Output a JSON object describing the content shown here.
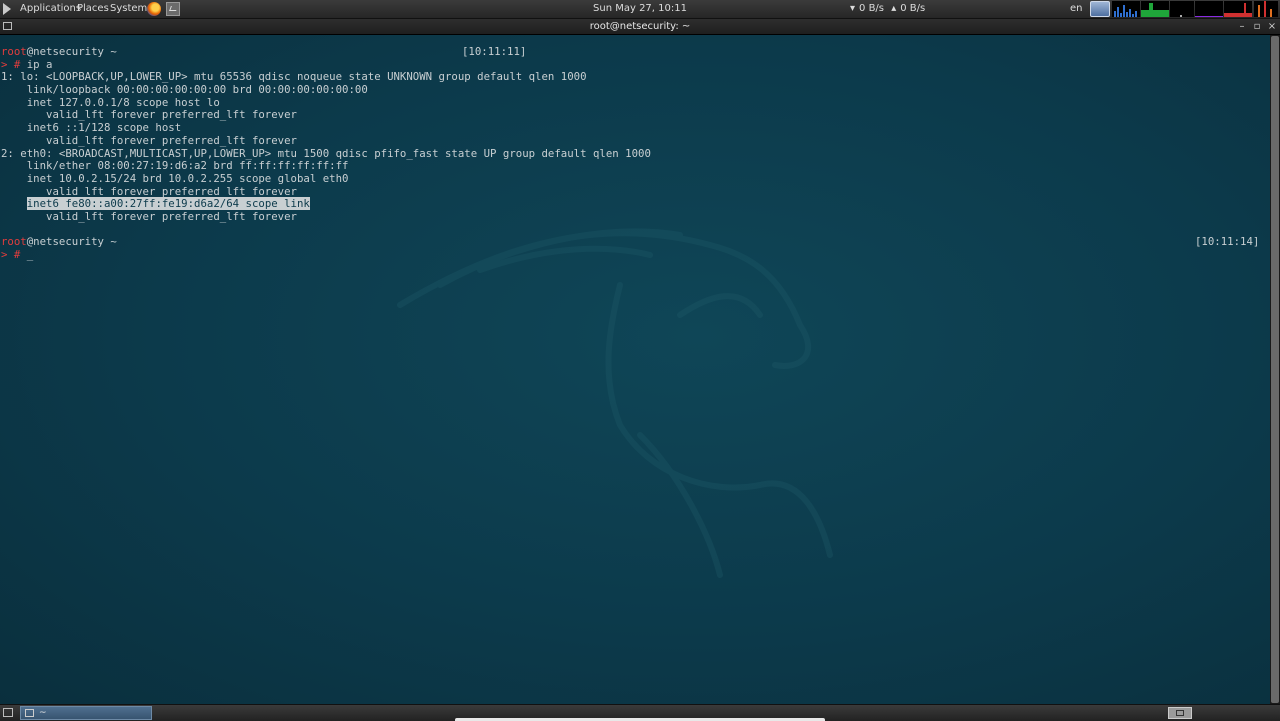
{
  "top_panel": {
    "menu": [
      "Applications",
      "Places",
      "System"
    ],
    "clock": "Sun May 27, 10:11",
    "net_down": "0 B/s",
    "net_up": "0 B/s",
    "language": "en"
  },
  "window": {
    "title": "root@netsecurity: ~",
    "buttons": [
      "–",
      "▫",
      "×"
    ]
  },
  "terminal": {
    "lines": [
      {
        "type": "prompt-info",
        "user": "root",
        "host": "@netsecurity ~",
        "time": "[10:11:11]"
      },
      {
        "type": "prompt",
        "arrow": ">",
        "hash": "#",
        "text": " ip a"
      },
      {
        "type": "text",
        "text": "1: lo: <LOOPBACK,UP,LOWER_UP> mtu 65536 qdisc noqueue state UNKNOWN group default qlen 1000"
      },
      {
        "type": "text",
        "text": "    link/loopback 00:00:00:00:00:00 brd 00:00:00:00:00:00"
      },
      {
        "type": "text",
        "text": "    inet 127.0.0.1/8 scope host lo"
      },
      {
        "type": "text",
        "text": "       valid_lft forever preferred_lft forever"
      },
      {
        "type": "text",
        "text": "    inet6 ::1/128 scope host"
      },
      {
        "type": "text",
        "text": "       valid_lft forever preferred_lft forever"
      },
      {
        "type": "text",
        "text": "2: eth0: <BROADCAST,MULTICAST,UP,LOWER_UP> mtu 1500 qdisc pfifo_fast state UP group default qlen 1000"
      },
      {
        "type": "text",
        "text": "    link/ether 08:00:27:19:d6:a2 brd ff:ff:ff:ff:ff:ff"
      },
      {
        "type": "text",
        "text": "    inet 10.0.2.15/24 brd 10.0.2.255 scope global eth0"
      },
      {
        "type": "text",
        "text": "       valid_lft forever preferred_lft forever"
      },
      {
        "type": "highlight",
        "indent": "    ",
        "text": "inet6 fe80::a00:27ff:fe19:d6a2/64 scope link"
      },
      {
        "type": "text",
        "text": "       valid_lft forever preferred_lft forever"
      },
      {
        "type": "blank",
        "text": ""
      },
      {
        "type": "prompt-info",
        "user": "root",
        "host": "@netsecurity ~",
        "time": "[10:11:14]"
      },
      {
        "type": "prompt",
        "arrow": ">",
        "hash": "#",
        "text": " _"
      }
    ]
  },
  "bottom_panel": {
    "taskbar_item": "~"
  }
}
